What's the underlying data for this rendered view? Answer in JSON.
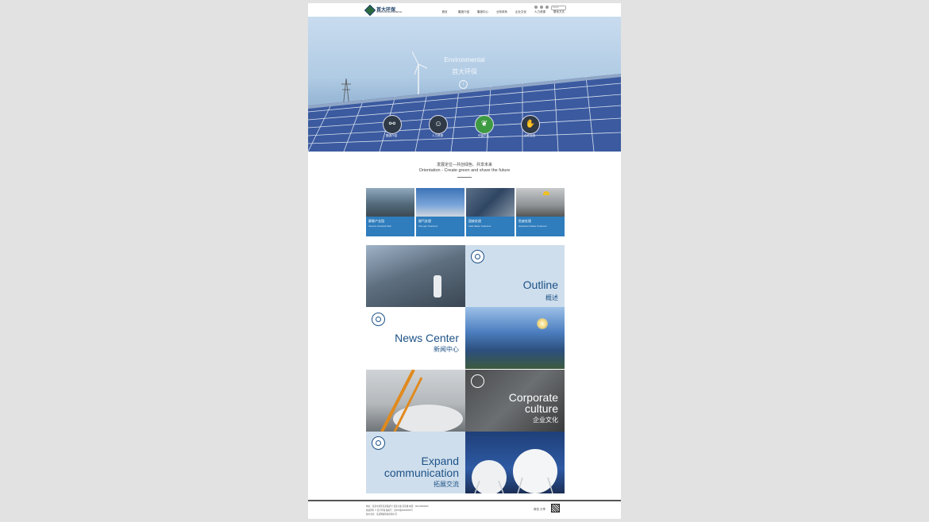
{
  "header": {
    "logo_text": "首大环保",
    "logo_sub": "SHOUDA ENVIRONMENTAL",
    "nav": [
      "首页",
      "集团介绍",
      "集团中心",
      "业务体系",
      "企业文化",
      "人力资源",
      "联系方式"
    ],
    "search_placeholder": "Search"
  },
  "hero": {
    "title_en": "Environmental",
    "title_cn": "首大环保",
    "icons": [
      {
        "icon": "network-icon",
        "label": "集团介绍"
      },
      {
        "icon": "users-icon",
        "label": "人力资源"
      },
      {
        "icon": "leaf-icon",
        "label": "环保产业"
      },
      {
        "icon": "handshake-icon",
        "label": "合作交流"
      }
    ]
  },
  "positioning": {
    "cn": "发展定位—共创绿色、共享未来",
    "en": "Orientation - Create green and share the future"
  },
  "cards": [
    {
      "cn": "静脉产业园",
      "en": "Vienous Industrial Park"
    },
    {
      "cn": "烟气处理",
      "en": "Flue gas Treatment"
    },
    {
      "cn": "固废处理",
      "en": "Solid Waste Treatment"
    },
    {
      "cn": "危废处理",
      "en": "Hazardous Waste Treatment"
    }
  ],
  "tiles": {
    "outline": {
      "en": "Outline",
      "cn": "概述"
    },
    "news": {
      "en": "News Center",
      "cn": "新闻中心"
    },
    "culture": {
      "en1": "Corporate",
      "en2": "culture",
      "cn": "企业文化"
    },
    "expand": {
      "en1": "Expand",
      "en2": "communication",
      "cn": "拓展交流"
    }
  },
  "footer": {
    "line1": "地址：某某市某区某某路某号 某某大厦 某某楼 电话：000-00000000",
    "line2": "版权所有 © 首大环保 备案号：某ICP备00000000号",
    "line3": "技术支持：某某网络科技有限公司",
    "share": "微信 分享"
  }
}
